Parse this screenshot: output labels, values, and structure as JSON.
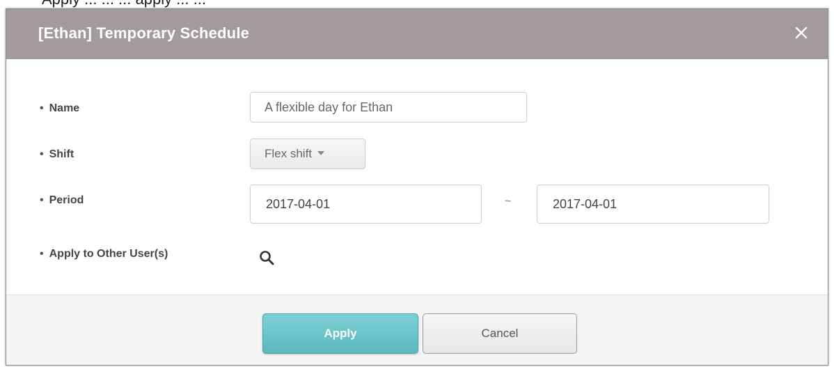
{
  "top_fragment": "Apply    ...  ...  ... apply ... ...",
  "dialog": {
    "title": "[Ethan] Temporary Schedule",
    "close_icon": "close-icon"
  },
  "form": {
    "name": {
      "label": "Name",
      "value": "A flexible day for Ethan"
    },
    "shift": {
      "label": "Shift",
      "selected": "Flex shift"
    },
    "period": {
      "label": "Period",
      "from": "2017-04-01",
      "separator": "~",
      "to": "2017-04-01"
    },
    "apply_users": {
      "label": "Apply to Other User(s)",
      "icon": "search-icon"
    }
  },
  "footer": {
    "apply_label": "Apply",
    "cancel_label": "Cancel"
  },
  "colors": {
    "titlebar": "#a29a9d",
    "apply_button": "#6cc4ca"
  }
}
